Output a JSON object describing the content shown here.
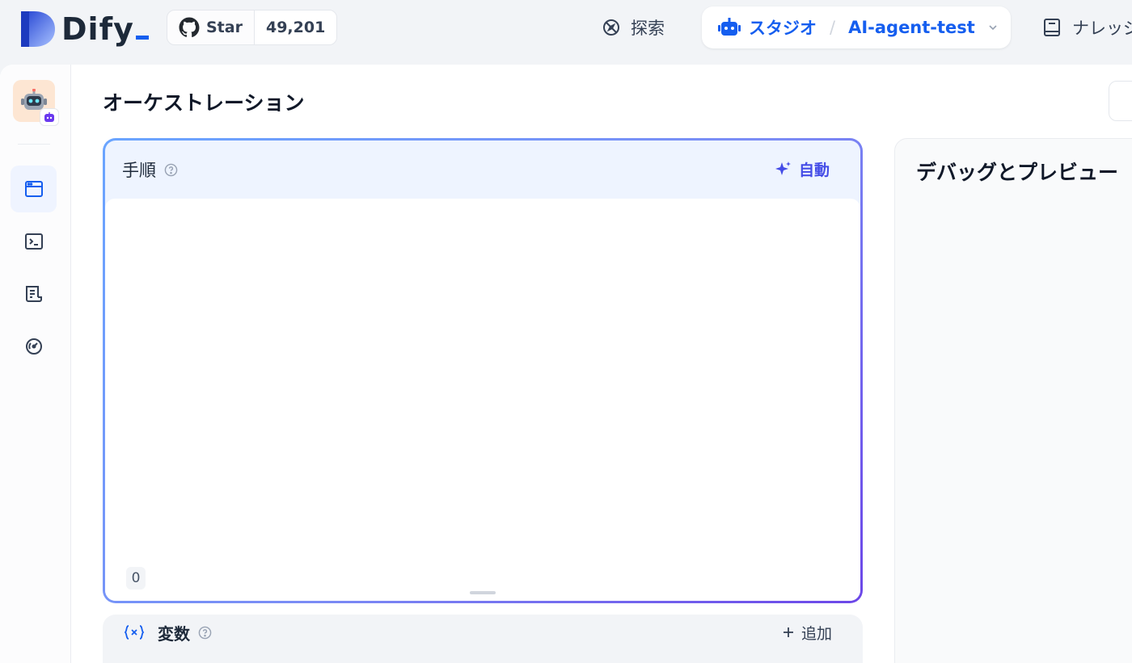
{
  "brand": {
    "name": "Dify"
  },
  "github": {
    "star_label": "Star",
    "star_count": "49,201"
  },
  "nav": {
    "explore": "探索",
    "studio": "スタジオ",
    "separator": "/",
    "app_name": "AI-agent-test",
    "knowledge": "ナレッジ"
  },
  "page": {
    "title": "オーケストレーション"
  },
  "prompt": {
    "title": "手順",
    "auto_label": "自動",
    "char_count": "0"
  },
  "variables": {
    "title": "変数",
    "add_label": "追加"
  },
  "debug": {
    "title": "デバッグとプレビュー"
  },
  "sidebar": {
    "items": [
      {
        "icon": "orchestrate-icon",
        "active": true
      },
      {
        "icon": "terminal-icon",
        "active": false
      },
      {
        "icon": "logs-icon",
        "active": false
      },
      {
        "icon": "monitoring-icon",
        "active": false
      }
    ]
  },
  "colors": {
    "accent": "#155eef",
    "indigo": "#444ce7",
    "gradient_start": "#6aa5ff",
    "gradient_end": "#6c47e8"
  }
}
